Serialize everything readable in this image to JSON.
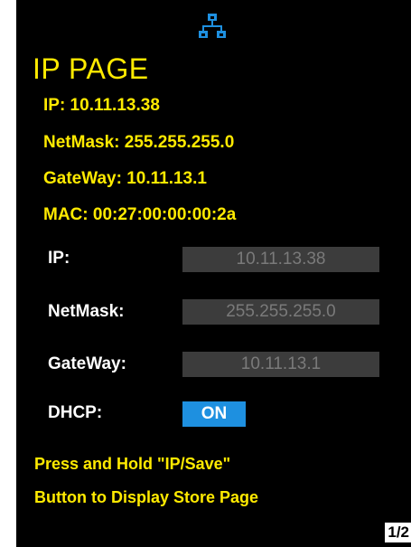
{
  "header": {
    "icon": "network-icon",
    "title": "IP PAGE"
  },
  "current_info": {
    "ip": "IP: 10.11.13.38",
    "netmask": "NetMask: 255.255.255.0",
    "gateway": "GateWay: 10.11.13.1",
    "mac": "MAC: 00:27:00:00:00:2a"
  },
  "fields": {
    "ip": {
      "label": "IP:",
      "value": "10.11.13.38"
    },
    "netmask": {
      "label": "NetMask:",
      "value": "255.255.255.0"
    },
    "gateway": {
      "label": "GateWay:",
      "value": "10.11.13.1"
    },
    "dhcp": {
      "label": "DHCP:",
      "value": "ON"
    }
  },
  "hint": {
    "line1": "Press and Hold \"IP/Save\"",
    "line2": "Button to Display Store Page"
  },
  "pager": "1/2",
  "colors": {
    "background": "#000000",
    "accent_text": "#ffea00",
    "field_bg": "#3c3c3c",
    "field_text": "#7a7a7a",
    "toggle_on": "#1e90e0"
  }
}
